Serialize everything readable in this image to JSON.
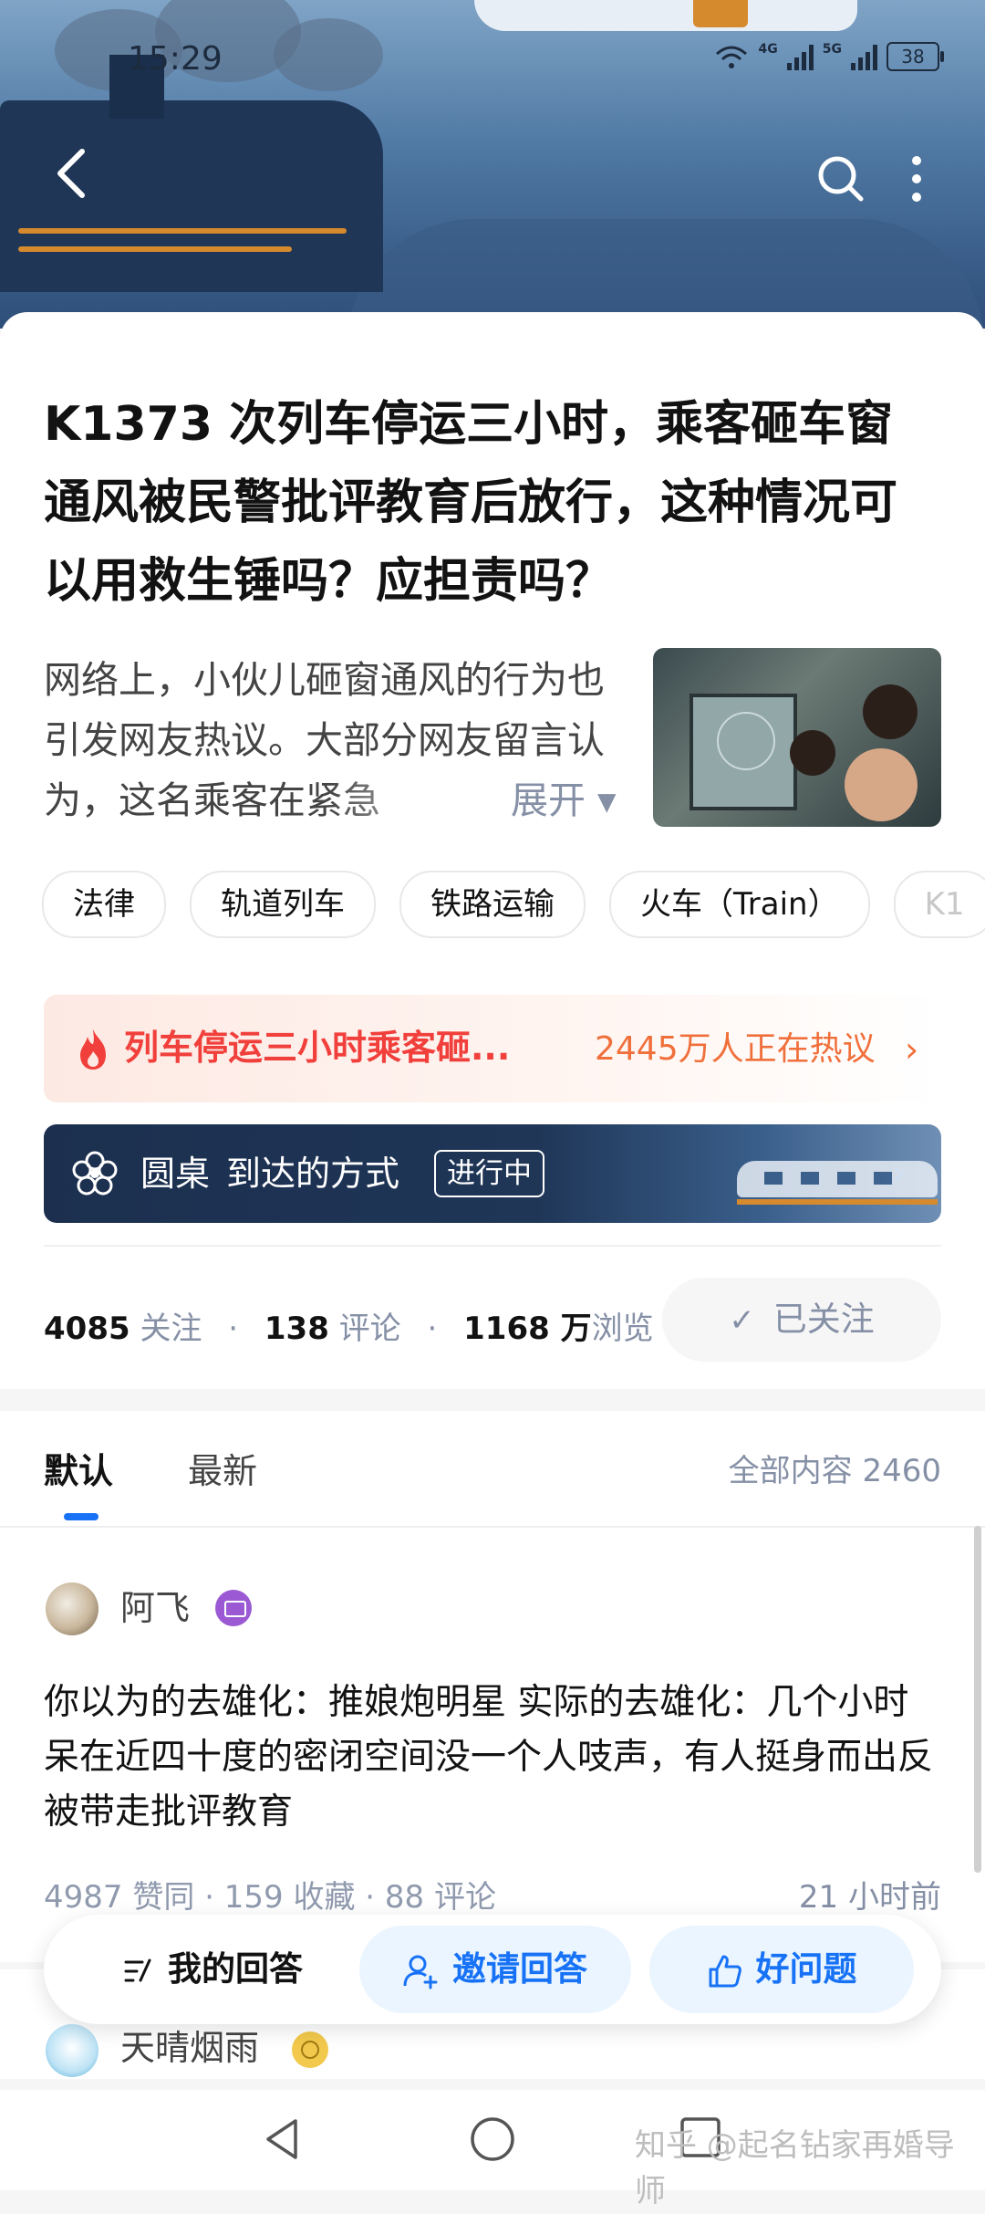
{
  "status_bar": {
    "time": "15:29",
    "network_a": "4G",
    "network_b": "5G",
    "battery": "38"
  },
  "nav": {
    "back_icon": "chevron-left-icon",
    "search_icon": "search-icon",
    "more_icon": "more-vertical-icon"
  },
  "question": {
    "title": "K1373 次列车停运三小时，乘客砸车窗通风被民警批评教育后放行，这种情况可以用救生锤吗？应担责吗？",
    "excerpt": "网络上，小伙儿砸窗通风的行为也引发网友热议。大部分网友留言认为，这名乘客在紧急",
    "expand": "展开 ▾",
    "tags": [
      "法律",
      "轨道列车",
      "铁路运输",
      "火车（Train）",
      "K1"
    ]
  },
  "hot": {
    "title": "列车停运三小时乘客砸...",
    "count": "2445万人正在热议",
    "arrow": "›",
    "icon": "fire-icon"
  },
  "roundtable": {
    "label": "圆桌",
    "topic": "到达的方式",
    "badge": "进行中",
    "arrow": "›",
    "icon": "flower-icon"
  },
  "stats": {
    "followers": "4085",
    "followers_label": "关注",
    "comments": "138",
    "comments_label": "评论",
    "views": "1168 万",
    "views_label": "浏览",
    "dot": "·"
  },
  "follow_button": {
    "check": "✓",
    "label": "已关注"
  },
  "tabs": {
    "default": "默认",
    "latest": "最新",
    "count": "全部内容 2460"
  },
  "answers": [
    {
      "author": "阿飞",
      "body": "你以为的去雄化：推娘炮明星 实际的去雄化：几个小时呆在近四十度的密闭空间没一个人吱声，有人挺身而出反被带走批评教育",
      "meta": "4987 赞同 · 159 收藏 · 88 评论",
      "time": "21 小时前"
    },
    {
      "author": "天晴烟雨"
    }
  ],
  "action_bar": {
    "mine": "我的回答",
    "invite": "邀请回答",
    "good": "好问题"
  },
  "watermark": "知乎 @起名钻家再婚导师",
  "colors": {
    "accent": "#1772f6",
    "hot_red": "#f1403c",
    "hot_orange": "#f0703c",
    "roundtable_bg": "#1c2f4f"
  }
}
